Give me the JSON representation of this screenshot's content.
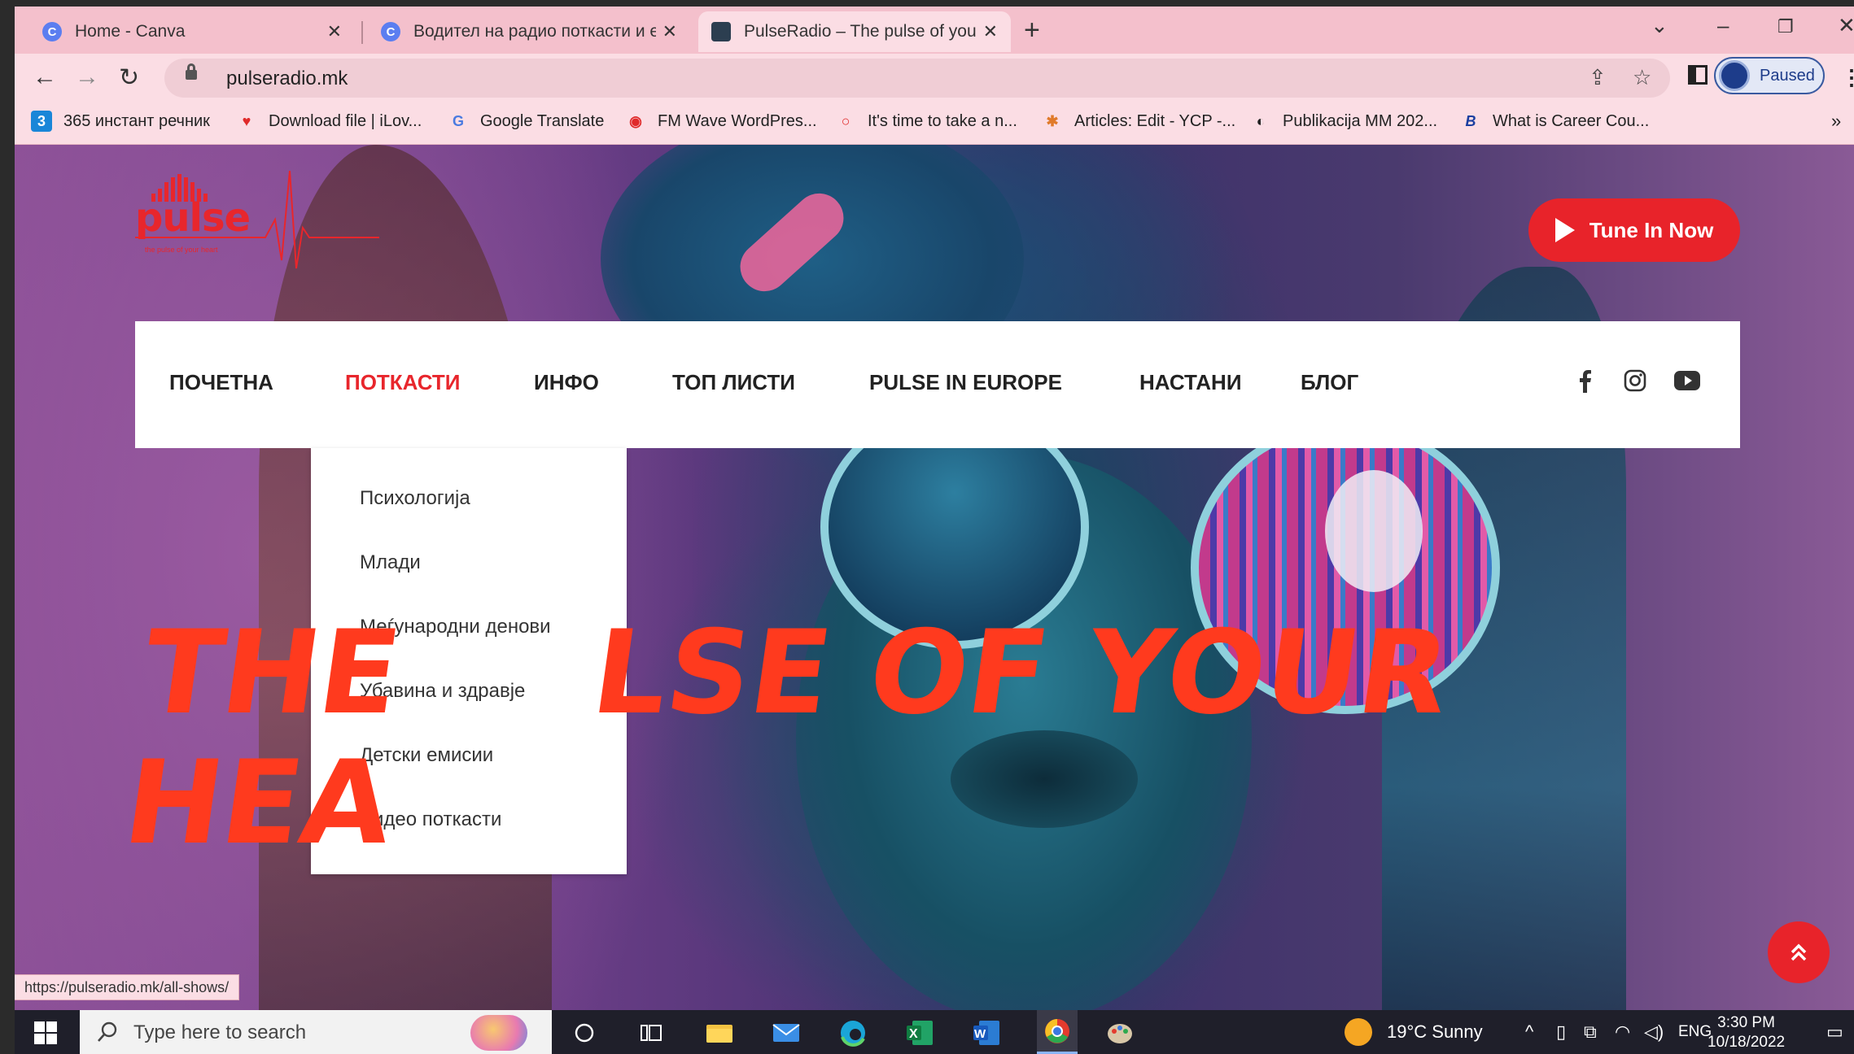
{
  "browser": {
    "tabs": [
      {
        "title": "Home - Canva",
        "favicon": "canva-icon",
        "color": "#5b7ef0"
      },
      {
        "title": "Водител на радио поткасти и ег",
        "favicon": "canva-icon",
        "color": "#5b7ef0"
      },
      {
        "title": "PulseRadio – The pulse of your h",
        "favicon": "pulseradio-icon",
        "color": "#2c3e50"
      }
    ],
    "close_glyph": "✕",
    "new_tab_glyph": "+",
    "url": "pulseradio.mk",
    "profile_label": "Paused",
    "bookmarks": [
      {
        "label": "365 инстант речник",
        "icon": "3",
        "color": "#1a86d8"
      },
      {
        "label": "Download file | iLov...",
        "icon": "♥",
        "color": "#e02a2a"
      },
      {
        "label": "Google Translate",
        "icon": "G",
        "color": "#4a7ae0"
      },
      {
        "label": "FM Wave WordPres...",
        "icon": "◉",
        "color": "#e02a2a"
      },
      {
        "label": "It's time to take a n...",
        "icon": "○",
        "color": "#e02a2a"
      },
      {
        "label": "Articles: Edit - YCP -...",
        "icon": "✱",
        "color": "#e07a2a"
      },
      {
        "label": "Publikacija MM 202...",
        "icon": "◐",
        "color": "#222"
      },
      {
        "label": "What is Career Cou...",
        "icon": "B",
        "color": "#1a3ea0"
      }
    ],
    "bookmarks_more": "»",
    "status_url": "https://pulseradio.mk/all-shows/"
  },
  "site": {
    "logo_text": "pulse",
    "logo_tagline": "the pulse of your heart",
    "tune_in_label": "Tune In Now",
    "nav": [
      {
        "label": "ПОЧЕТНА",
        "active": false
      },
      {
        "label": "ПОТКАСТИ",
        "active": true
      },
      {
        "label": "ИНФО",
        "active": false
      },
      {
        "label": "ТОП ЛИСТИ",
        "active": false
      },
      {
        "label": "PULSE IN EUROPE",
        "active": false
      },
      {
        "label": "НАСТАНИ",
        "active": false
      },
      {
        "label": "БЛОГ",
        "active": false
      }
    ],
    "social": [
      "facebook-icon",
      "instagram-icon",
      "youtube-icon"
    ],
    "dropdown": [
      "Психологија",
      "Млади",
      "Меѓународни денови",
      "Убавина и здравје",
      "Детски емисии",
      "Видео поткасти"
    ],
    "hero_line1_left": "THE",
    "hero_line1_right": "LSE OF YOUR",
    "hero_line2": "HEA",
    "accent_color": "#e8232a"
  },
  "taskbar": {
    "search_placeholder": "Type here to search",
    "weather": "19°C  Sunny",
    "language": "ENG",
    "time": "3:30 PM",
    "date": "10/18/2022"
  }
}
